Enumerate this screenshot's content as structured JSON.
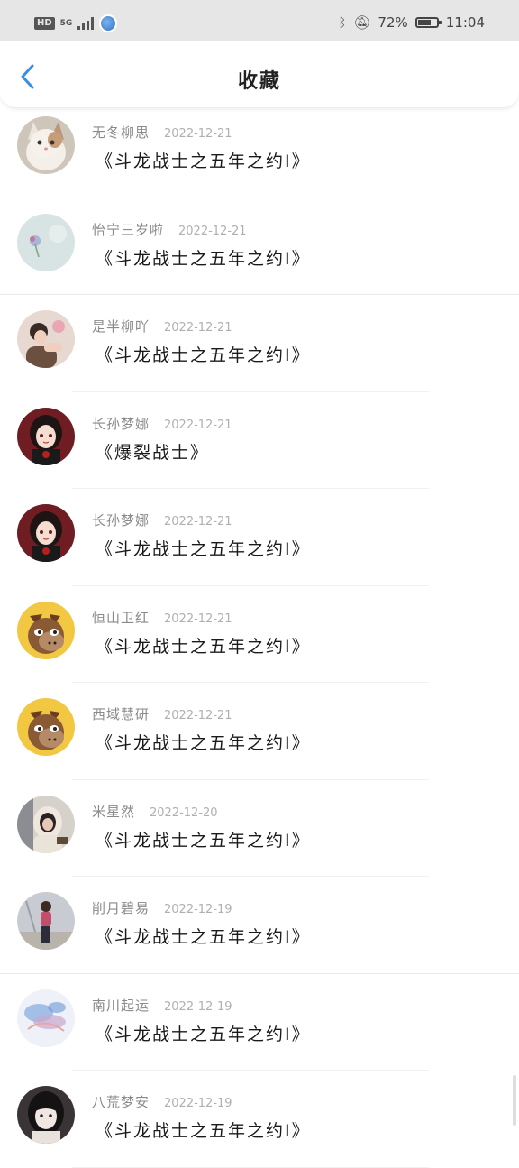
{
  "status_bar": {
    "hd_label": "HD",
    "network_label": "5G",
    "battery_text": "72%",
    "battery_level": 0.72,
    "time": "11:04",
    "icons": [
      "bluetooth-icon",
      "mute-icon"
    ]
  },
  "header": {
    "title": "收藏",
    "back_icon": "chevron-left-icon",
    "accent_color": "#3a8ee6"
  },
  "items": [
    {
      "username": "无冬柳思",
      "date": "2022-12-21",
      "title": "《斗龙战士之五年之约I》",
      "avatar": "cat"
    },
    {
      "username": "怡宁三岁啦",
      "date": "2022-12-21",
      "title": "《斗龙战士之五年之约I》",
      "avatar": "pale-flower"
    },
    {
      "username": "是半柳吖",
      "date": "2022-12-21",
      "title": "《斗龙战士之五年之约I》",
      "avatar": "girl-photo"
    },
    {
      "username": "长孙梦娜",
      "date": "2022-12-21",
      "title": "《爆裂战士》",
      "avatar": "anime-girl"
    },
    {
      "username": "长孙梦娜",
      "date": "2022-12-21",
      "title": "《斗龙战士之五年之约I》",
      "avatar": "anime-girl"
    },
    {
      "username": "恒山卫红",
      "date": "2022-12-21",
      "title": "《斗龙战士之五年之约I》",
      "avatar": "horse-cartoon"
    },
    {
      "username": "西域慧研",
      "date": "2022-12-21",
      "title": "《斗龙战士之五年之约I》",
      "avatar": "horse-cartoon"
    },
    {
      "username": "米星然",
      "date": "2022-12-20",
      "title": "《斗龙战士之五年之约I》",
      "avatar": "girl-hood"
    },
    {
      "username": "削月碧易",
      "date": "2022-12-19",
      "title": "《斗龙战士之五年之约I》",
      "avatar": "girl-street"
    },
    {
      "username": "南川起运",
      "date": "2022-12-19",
      "title": "《斗龙战士之五年之约I》",
      "avatar": "watercolor"
    },
    {
      "username": "八荒梦安",
      "date": "2022-12-19",
      "title": "《斗龙战士之五年之约I》",
      "avatar": "girl-dark"
    }
  ]
}
